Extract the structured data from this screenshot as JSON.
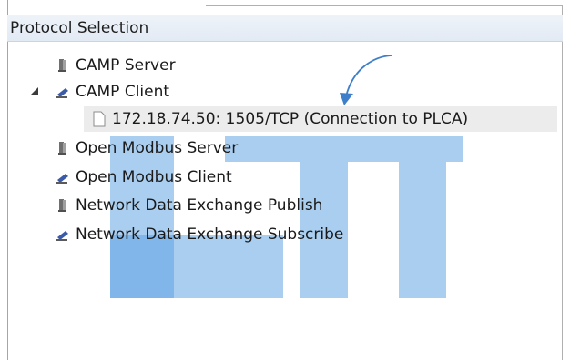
{
  "panel": {
    "title": "Protocol Selection"
  },
  "tree": {
    "items": [
      {
        "label": "CAMP Server",
        "icon": "server-icon"
      },
      {
        "label": "CAMP Client",
        "icon": "client-icon",
        "expanded": true,
        "children": [
          {
            "label": "172.18.74.50: 1505/TCP (Connection to PLCA)",
            "icon": "document-icon"
          }
        ]
      },
      {
        "label": "Open Modbus Server",
        "icon": "server-icon"
      },
      {
        "label": "Open Modbus Client",
        "icon": "client-icon"
      },
      {
        "label": "Network Data Exchange Publish",
        "icon": "server-icon"
      },
      {
        "label": "Network Data Exchange Subscribe",
        "icon": "client-icon"
      }
    ]
  },
  "colors": {
    "watermark": "#5aa1e3",
    "arrow": "#3f7fc9",
    "selected_row": "#ececec",
    "header_bg": "#e6edf6"
  }
}
